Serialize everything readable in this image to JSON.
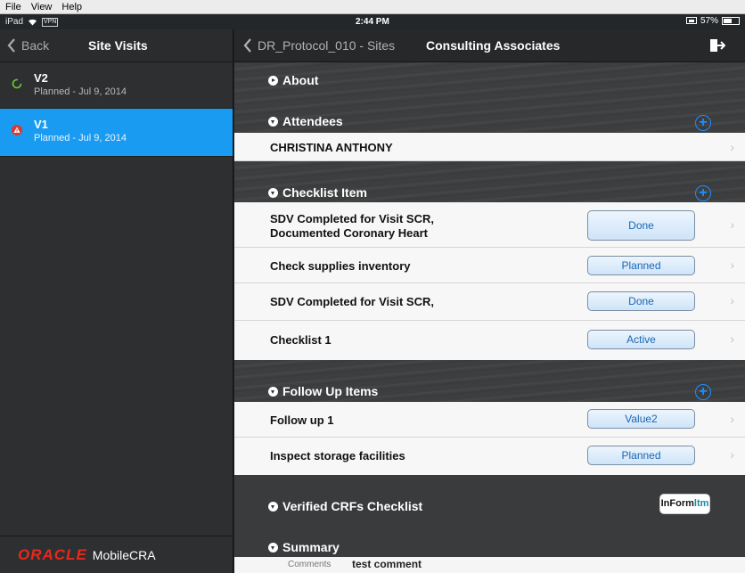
{
  "menubar": {
    "items": [
      "File",
      "View",
      "Help"
    ]
  },
  "status": {
    "device": "iPad",
    "vpn": "VPN",
    "time": "2:44 PM",
    "battery": "57%",
    "battery_level": 0.57
  },
  "sidebar": {
    "back_label": "Back",
    "title": "Site Visits",
    "visits": [
      {
        "name": "V2",
        "sub": "Planned - Jul 9, 2014"
      },
      {
        "name": "V1",
        "sub": "Planned - Jul 9, 2014"
      }
    ],
    "footer": {
      "brand": "ORACLE",
      "product": "MobileCRA"
    }
  },
  "main": {
    "back_label": "DR_Protocol_010 - Sites",
    "title": "Consulting Associates",
    "about": "About",
    "attendees": {
      "title": "Attendees",
      "items": [
        "CHRISTINA ANTHONY"
      ]
    },
    "checklist": {
      "title": "Checklist Item",
      "items": [
        {
          "line1": "SDV Completed for Visit SCR,",
          "line2": "Documented Coronary Heart",
          "status": "Done"
        },
        {
          "line1": "Check supplies inventory",
          "status": "Planned"
        },
        {
          "line1": "SDV Completed for Visit SCR,",
          "status": "Done"
        },
        {
          "line1": "Checklist 1",
          "status": "Active"
        }
      ]
    },
    "followup": {
      "title": "Follow Up Items",
      "items": [
        {
          "label": "Follow up 1",
          "status": "Value2"
        },
        {
          "label": "Inspect storage facilities",
          "status": "Planned"
        }
      ]
    },
    "crf": {
      "title": "Verified CRFs Checklist",
      "badge_main": "InForm",
      "badge_sub": "ltm"
    },
    "summary": {
      "title": "Summary",
      "comments_label": "Comments",
      "comments_value": "test comment"
    }
  }
}
